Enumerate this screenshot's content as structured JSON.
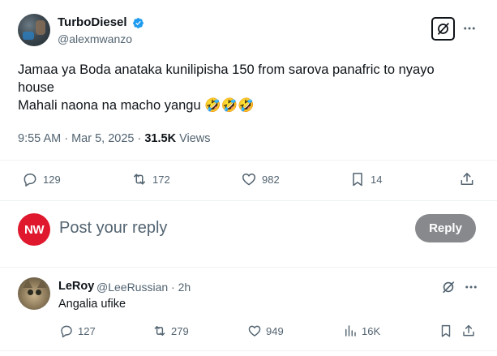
{
  "tweet": {
    "author_name": "TurboDiesel",
    "author_handle": "@alexmwanzo",
    "text_lines": [
      "Jamaa ya Boda anataka kunilipisha 150 from sarova panafric to nyayo",
      "house",
      "Mahali naona na macho yangu 🤣🤣🤣"
    ],
    "time": "9:55 AM · Mar 5, 2025 · ",
    "views_count": "31.5K",
    "views_label": " Views",
    "actions": {
      "replies": "129",
      "reposts": "172",
      "likes": "982",
      "bookmarks": "14"
    },
    "icons": [
      "verified-badge-icon",
      "grok-icon",
      "more-icon",
      "reply-icon",
      "repost-icon",
      "like-icon",
      "bookmark-icon",
      "share-icon"
    ]
  },
  "composer": {
    "avatar_text": "NW",
    "placeholder": "Post your reply",
    "reply_button_label": "Reply"
  },
  "reply": {
    "author_name": "LeRoy",
    "author_handle": "@LeeRussian · 2h",
    "text": "Angalia ufike",
    "actions": {
      "replies": "127",
      "reposts": "279",
      "likes": "949",
      "views": "16K"
    }
  },
  "colors": {
    "text": "#0f1419",
    "secondary": "#536471",
    "verified": "#1d9bf0",
    "reply_button": "#87898c",
    "nw_red": "#e0182d",
    "divider": "#eff3f4"
  }
}
